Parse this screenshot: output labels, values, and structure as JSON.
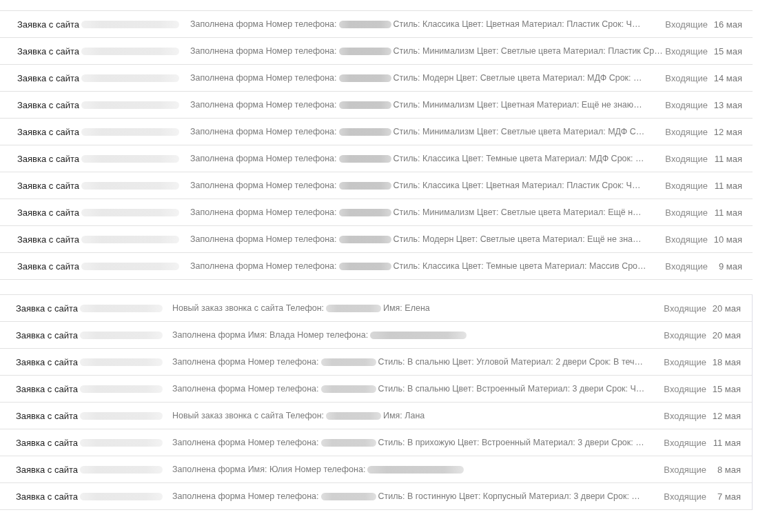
{
  "lists": [
    {
      "framed": false,
      "rows": [
        {
          "sender": [
            {
              "kind": "text",
              "text": "Заявка с сайта"
            },
            {
              "kind": "redacted"
            }
          ],
          "preview": [
            {
              "kind": "text",
              "text": "Заполнена форма Номер телефона:"
            },
            {
              "kind": "redacted"
            },
            {
              "kind": "text",
              "text": "Стиль: Классика Цвет: Цветная Материал: Пластик Срок: Ч…"
            }
          ],
          "folder": "Входящие",
          "date": "16 мая"
        },
        {
          "sender": [
            {
              "kind": "text",
              "text": "Заявка с сайта"
            },
            {
              "kind": "redacted"
            }
          ],
          "preview": [
            {
              "kind": "text",
              "text": "Заполнена форма Номер телефона:"
            },
            {
              "kind": "redacted"
            },
            {
              "kind": "text",
              "text": "Стиль: Минимализм Цвет: Светлые цвета Материал: Пластик Ср…"
            }
          ],
          "folder": "Входящие",
          "date": "15 мая"
        },
        {
          "sender": [
            {
              "kind": "text",
              "text": "Заявка с сайта"
            },
            {
              "kind": "redacted"
            }
          ],
          "preview": [
            {
              "kind": "text",
              "text": "Заполнена форма Номер телефона:"
            },
            {
              "kind": "redacted"
            },
            {
              "kind": "text",
              "text": "Стиль: Модерн Цвет: Светлые цвета Материал: МДФ Срок: …"
            }
          ],
          "folder": "Входящие",
          "date": "14 мая"
        },
        {
          "sender": [
            {
              "kind": "text",
              "text": "Заявка с сайта"
            },
            {
              "kind": "redacted"
            }
          ],
          "preview": [
            {
              "kind": "text",
              "text": "Заполнена форма Номер телефона:"
            },
            {
              "kind": "redacted"
            },
            {
              "kind": "text",
              "text": "Стиль: Минимализм Цвет: Цветная Материал: Ещё не знаю…"
            }
          ],
          "folder": "Входящие",
          "date": "13 мая"
        },
        {
          "sender": [
            {
              "kind": "text",
              "text": "Заявка с сайта"
            },
            {
              "kind": "redacted"
            }
          ],
          "preview": [
            {
              "kind": "text",
              "text": "Заполнена форма Номер телефона:"
            },
            {
              "kind": "redacted"
            },
            {
              "kind": "text",
              "text": "Стиль: Минимализм Цвет: Светлые цвета Материал: МДФ С…"
            }
          ],
          "folder": "Входящие",
          "date": "12 мая"
        },
        {
          "sender": [
            {
              "kind": "text",
              "text": "Заявка с сайта"
            },
            {
              "kind": "redacted"
            }
          ],
          "preview": [
            {
              "kind": "text",
              "text": "Заполнена форма Номер телефона:"
            },
            {
              "kind": "redacted"
            },
            {
              "kind": "text",
              "text": "Стиль: Классика Цвет: Темные цвета Материал: МДФ Срок: …"
            }
          ],
          "folder": "Входящие",
          "date": "11 мая"
        },
        {
          "sender": [
            {
              "kind": "text",
              "text": "Заявка с сайта"
            },
            {
              "kind": "redacted"
            }
          ],
          "preview": [
            {
              "kind": "text",
              "text": "Заполнена форма Номер телефона:"
            },
            {
              "kind": "redacted"
            },
            {
              "kind": "text",
              "text": "Стиль: Классика Цвет: Цветная Материал: Пластик Срок: Ч…"
            }
          ],
          "folder": "Входящие",
          "date": "11 мая"
        },
        {
          "sender": [
            {
              "kind": "text",
              "text": "Заявка с сайта"
            },
            {
              "kind": "redacted"
            }
          ],
          "preview": [
            {
              "kind": "text",
              "text": "Заполнена форма Номер телефона:"
            },
            {
              "kind": "redacted"
            },
            {
              "kind": "text",
              "text": "Стиль: Минимализм Цвет: Светлые цвета Материал: Ещё н…"
            }
          ],
          "folder": "Входящие",
          "date": "11 мая"
        },
        {
          "sender": [
            {
              "kind": "text",
              "text": "Заявка с сайта"
            },
            {
              "kind": "redacted"
            }
          ],
          "preview": [
            {
              "kind": "text",
              "text": "Заполнена форма Номер телефона:"
            },
            {
              "kind": "redacted"
            },
            {
              "kind": "text",
              "text": "Стиль: Модерн Цвет: Светлые цвета Материал: Ещё не зна…"
            }
          ],
          "folder": "Входящие",
          "date": "10 мая"
        },
        {
          "sender": [
            {
              "kind": "text",
              "text": "Заявка с сайта"
            },
            {
              "kind": "redacted"
            }
          ],
          "preview": [
            {
              "kind": "text",
              "text": "Заполнена форма Номер телефона:"
            },
            {
              "kind": "redacted"
            },
            {
              "kind": "text",
              "text": "Стиль: Классика Цвет: Темные цвета Материал: Массив Сро…"
            }
          ],
          "folder": "Входящие",
          "date": "9 мая"
        }
      ]
    },
    {
      "framed": true,
      "rows": [
        {
          "sender": [
            {
              "kind": "text",
              "text": "Заявка с сайта"
            },
            {
              "kind": "redacted"
            }
          ],
          "preview": [
            {
              "kind": "text",
              "text": "Новый заказ звонка с сайта Телефон:"
            },
            {
              "kind": "redacted"
            },
            {
              "kind": "text",
              "text": "Имя: Елена"
            }
          ],
          "folder": "Входящие",
          "date": "20 мая"
        },
        {
          "sender": [
            {
              "kind": "text",
              "text": "Заявка с сайта"
            },
            {
              "kind": "redacted"
            }
          ],
          "preview": [
            {
              "kind": "text",
              "text": "Заполнена форма Имя: Влада Номер телефона:"
            },
            {
              "kind": "redacted"
            }
          ],
          "folder": "Входящие",
          "date": "20 мая"
        },
        {
          "sender": [
            {
              "kind": "text",
              "text": "Заявка с сайта"
            },
            {
              "kind": "redacted"
            }
          ],
          "preview": [
            {
              "kind": "text",
              "text": "Заполнена форма Номер телефона:"
            },
            {
              "kind": "redacted"
            },
            {
              "kind": "text",
              "text": "Стиль: В спальню Цвет: Угловой Материал: 2 двери Срок: В теч…"
            }
          ],
          "folder": "Входящие",
          "date": "18 мая"
        },
        {
          "sender": [
            {
              "kind": "text",
              "text": "Заявка с сайта"
            },
            {
              "kind": "redacted"
            }
          ],
          "preview": [
            {
              "kind": "text",
              "text": "Заполнена форма Номер телефона:"
            },
            {
              "kind": "redacted"
            },
            {
              "kind": "text",
              "text": "Стиль: В спальню Цвет: Встроенный Материал: 3 двери Срок: Ч…"
            }
          ],
          "folder": "Входящие",
          "date": "15 мая"
        },
        {
          "sender": [
            {
              "kind": "text",
              "text": "Заявка с сайта"
            },
            {
              "kind": "redacted"
            }
          ],
          "preview": [
            {
              "kind": "text",
              "text": "Новый заказ звонка с сайта Телефон:"
            },
            {
              "kind": "redacted"
            },
            {
              "kind": "text",
              "text": "Имя: Лана"
            }
          ],
          "folder": "Входящие",
          "date": "12 мая"
        },
        {
          "sender": [
            {
              "kind": "text",
              "text": "Заявка с сайта"
            },
            {
              "kind": "redacted"
            }
          ],
          "preview": [
            {
              "kind": "text",
              "text": "Заполнена форма Номер телефона:"
            },
            {
              "kind": "redacted"
            },
            {
              "kind": "text",
              "text": "Стиль: В прихожую Цвет: Встроенный Материал: 3 двери Срок: …"
            }
          ],
          "folder": "Входящие",
          "date": "11 мая"
        },
        {
          "sender": [
            {
              "kind": "text",
              "text": "Заявка с сайта"
            },
            {
              "kind": "redacted"
            }
          ],
          "preview": [
            {
              "kind": "text",
              "text": "Заполнена форма Имя: Юлия Номер телефона:"
            },
            {
              "kind": "redacted"
            }
          ],
          "folder": "Входящие",
          "date": "8 мая"
        },
        {
          "sender": [
            {
              "kind": "text",
              "text": "Заявка с сайта"
            },
            {
              "kind": "redacted"
            }
          ],
          "preview": [
            {
              "kind": "text",
              "text": "Заполнена форма Номер телефона:"
            },
            {
              "kind": "redacted"
            },
            {
              "kind": "text",
              "text": "Стиль: В гостинную Цвет: Корпусный Материал: 3 двери Срок: …"
            }
          ],
          "folder": "Входящие",
          "date": "7 мая"
        }
      ]
    }
  ]
}
